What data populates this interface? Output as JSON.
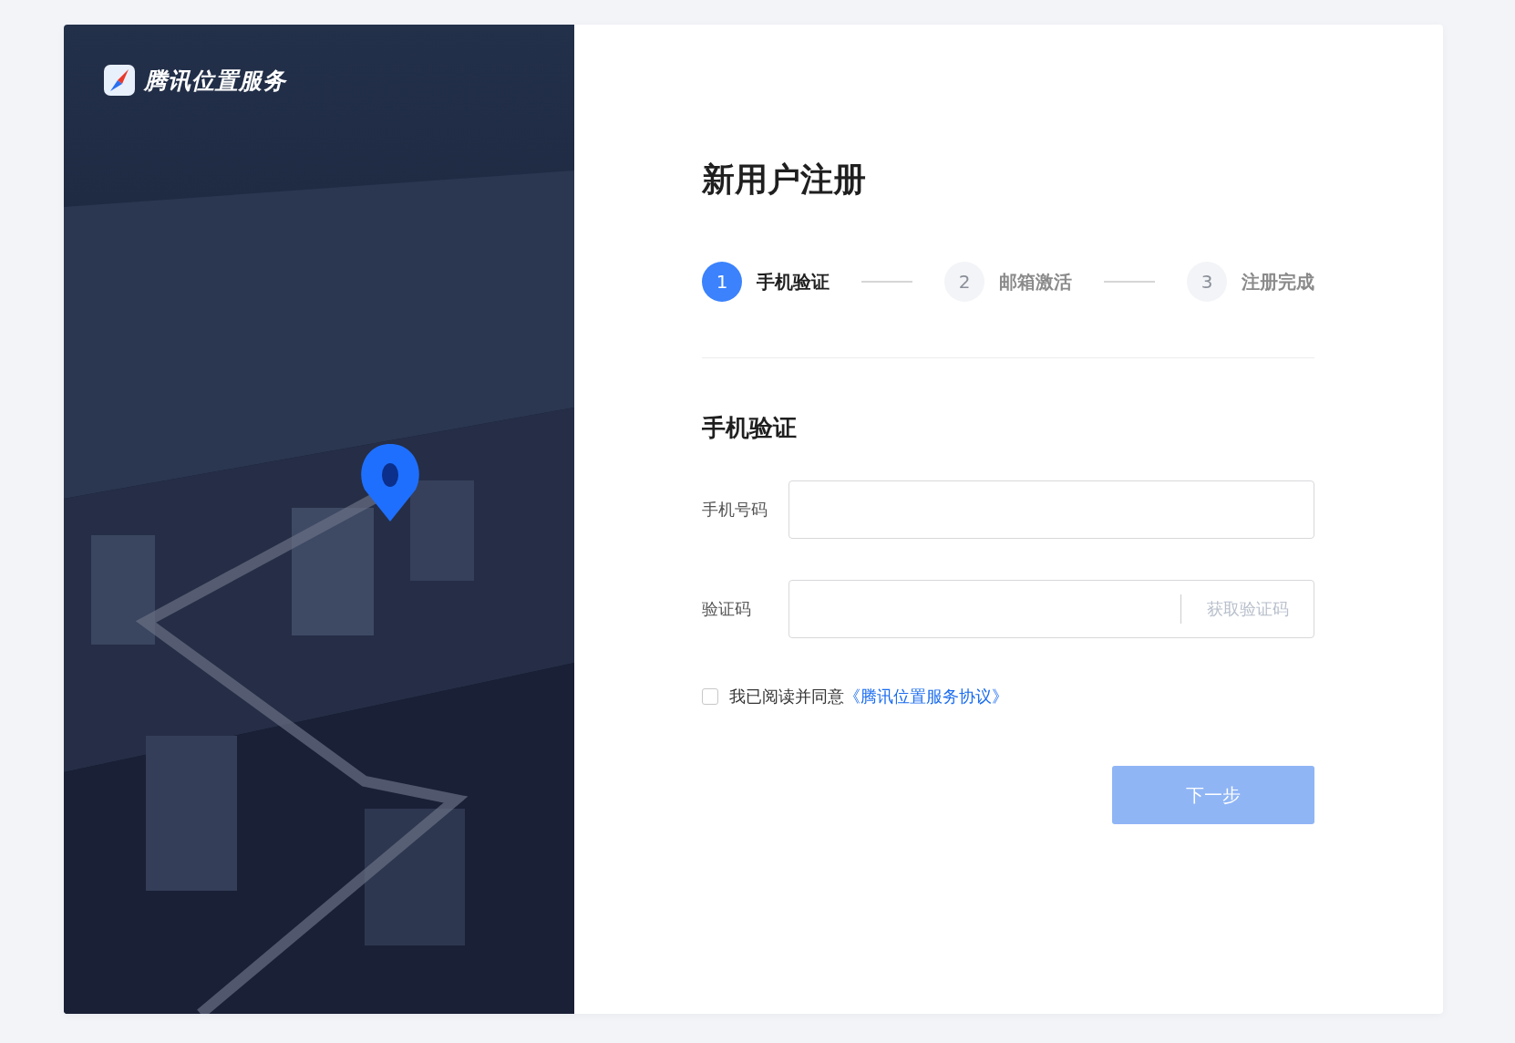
{
  "logo": {
    "text": "腾讯位置服务"
  },
  "title": "新用户注册",
  "steps": [
    {
      "number": "1",
      "label": "手机验证",
      "selected": true
    },
    {
      "number": "2",
      "label": "邮箱激活",
      "selected": false
    },
    {
      "number": "3",
      "label": "注册完成",
      "selected": false
    }
  ],
  "section_title": "手机验证",
  "fields": [
    {
      "kind": "text",
      "label": "手机号码"
    },
    {
      "kind": "code",
      "label": "验证码",
      "action": "获取验证码"
    }
  ],
  "agreement": {
    "checked": false,
    "text": "我已阅读并同意",
    "link": "《腾讯位置服务协议》"
  },
  "next_button": {
    "label": "下一步",
    "disabled": true
  }
}
